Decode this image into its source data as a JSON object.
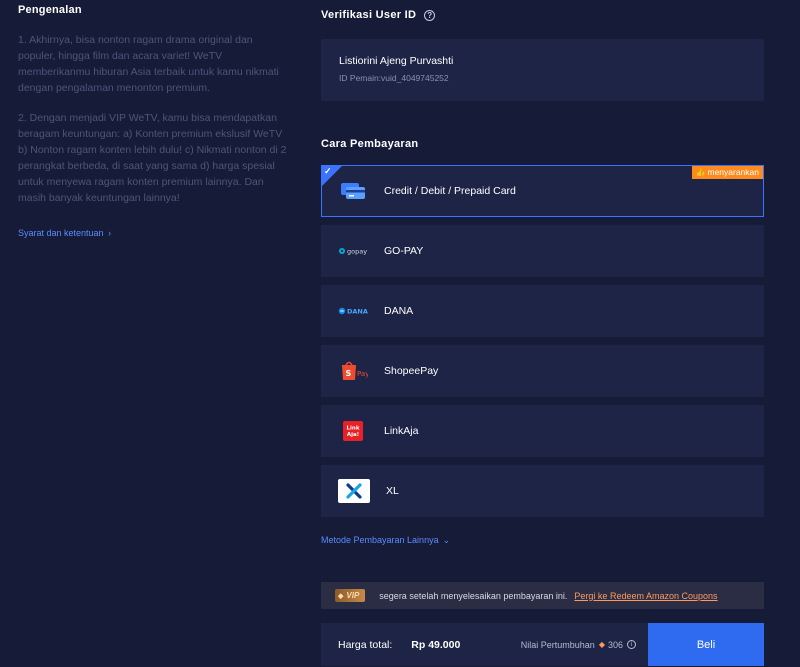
{
  "intro": {
    "title": "Pengenalan",
    "p1": "1. Akhirnya, bisa nonton ragam drama original dan populer, hingga film dan acara variet! WeTV memberikanmu hiburan Asia terbaik untuk kamu nikmati dengan pengalaman menonton premium.",
    "p2": "2. Dengan menjadi VIP WeTV, kamu bisa mendapatkan beragam keuntungan: a) Konten premium ekslusif WeTV b) Nonton ragam konten lebih dulu! c) Nikmati nonton di 2 perangkat berbeda, di saat yang sama d) harga spesial untuk menyewa ragam konten premium lainnya. Dan masih banyak keuntungan lainnya!",
    "terms_link": "Syarat dan ketentuan"
  },
  "user_verification": {
    "title": "Verifikasi User ID",
    "name": "Listiorini Ajeng Purvashti",
    "player_id": "ID Pemain:vuid_4049745252"
  },
  "payment": {
    "title": "Cara Pembayaran",
    "recommended_badge": "menyarankan",
    "methods": [
      {
        "label": "Credit / Debit / Prepaid Card",
        "icon": "credit-card-icon",
        "selected": true
      },
      {
        "label": "GO-PAY",
        "icon": "gopay-logo-icon",
        "logo_text": "gopay"
      },
      {
        "label": "DANA",
        "icon": "dana-logo-icon",
        "logo_text": "DANA"
      },
      {
        "label": "ShopeePay",
        "icon": "shopeepay-logo-icon",
        "logo_text": "Pay"
      },
      {
        "label": "LinkAja",
        "icon": "linkaja-logo-icon",
        "logo_text": "Link Aja!"
      },
      {
        "label": "XL",
        "icon": "xl-logo-icon"
      }
    ],
    "more_methods": "Metode Pembayaran Lainnya"
  },
  "promo": {
    "vip_tag": "VIP",
    "text": "segera setelah menyelesaikan pembayaran ini.",
    "link": "Pergi ke Redeem Amazon Coupons"
  },
  "footer": {
    "price_label": "Harga total:",
    "price": "Rp 49.000",
    "growth_label": "Nilai Pertumbuhan",
    "growth_value": "306",
    "buy_button": "Beli"
  },
  "colors": {
    "background": "#161b38",
    "card": "#1e2446",
    "accent": "#3a73ff",
    "badge": "#ff8a1e"
  }
}
